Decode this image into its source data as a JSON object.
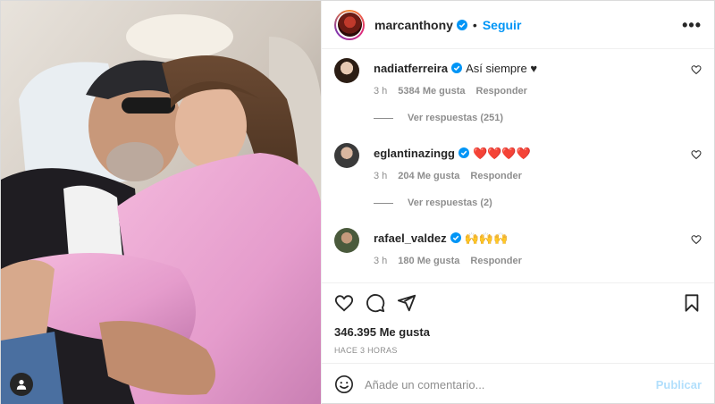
{
  "post": {
    "username": "marcanthony",
    "follow_label": "Seguir",
    "dot": "•",
    "more_label": "•••"
  },
  "comments": [
    {
      "username": "nadiatferreira",
      "text": "Así siempre ♥",
      "time": "3 h",
      "likes": "5384 Me gusta",
      "reply_label": "Responder",
      "replies_label": "Ver respuestas (251)"
    },
    {
      "username": "eglantinazingg",
      "text": "❤️❤️❤️❤️",
      "time": "3 h",
      "likes": "204 Me gusta",
      "reply_label": "Responder",
      "replies_label": "Ver respuestas (2)"
    },
    {
      "username": "rafael_valdez",
      "text": "🙌🙌🙌",
      "time": "3 h",
      "likes": "180 Me gusta",
      "reply_label": "Responder"
    }
  ],
  "stats": {
    "likes_total": "346.395 Me gusta",
    "time_ago": "Hace 3 horas"
  },
  "composer": {
    "placeholder": "Añade un comentario...",
    "publish_label": "Publicar"
  },
  "colors": {
    "accent": "#0095f6",
    "publish_disabled": "#b2dffc",
    "heart_red": "#ed4956"
  }
}
